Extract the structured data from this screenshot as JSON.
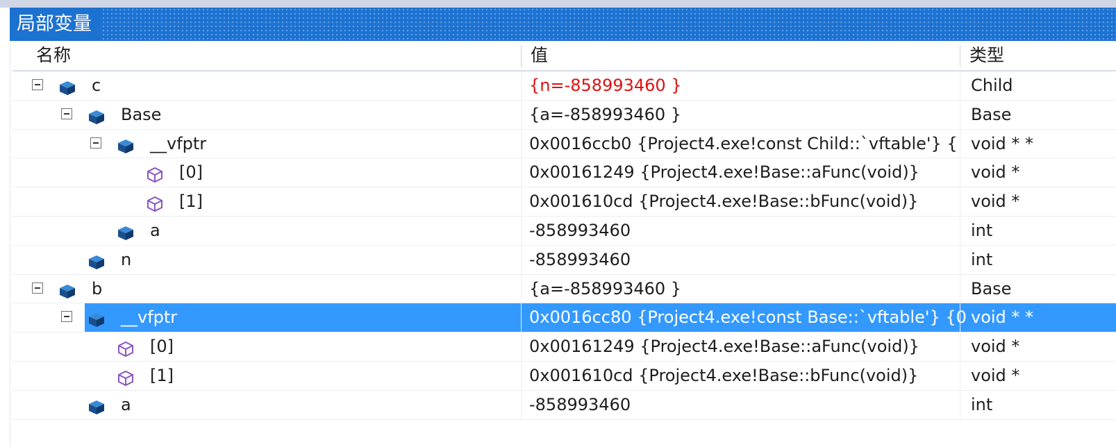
{
  "window": {
    "title": "局部变量"
  },
  "columns": {
    "name": "名称",
    "value": "值",
    "type": "类型"
  },
  "colors": {
    "accent": "#1c72d0",
    "selection": "#3399ff",
    "changed": "#e01010"
  },
  "rows": [
    {
      "name": "c",
      "value": "{n=-858993460 }",
      "type": "Child",
      "depth": 0,
      "expandable": true,
      "icon": "field-icon",
      "changed": true
    },
    {
      "name": "Base",
      "value": "{a=-858993460 }",
      "type": "Base",
      "depth": 1,
      "expandable": true,
      "icon": "field-icon"
    },
    {
      "name": "__vfptr",
      "value": "0x0016ccb0 {Project4.exe!const Child::`vftable'} {",
      "type": "void * *",
      "depth": 2,
      "expandable": true,
      "icon": "field-icon"
    },
    {
      "name": "[0]",
      "value": "0x00161249 {Project4.exe!Base::aFunc(void)}",
      "type": "void *",
      "depth": 3,
      "expandable": false,
      "icon": "element-icon"
    },
    {
      "name": "[1]",
      "value": "0x001610cd {Project4.exe!Base::bFunc(void)}",
      "type": "void *",
      "depth": 3,
      "expandable": false,
      "icon": "element-icon"
    },
    {
      "name": "a",
      "value": "-858993460",
      "type": "int",
      "depth": 2,
      "expandable": false,
      "icon": "field-icon"
    },
    {
      "name": "n",
      "value": "-858993460",
      "type": "int",
      "depth": 1,
      "expandable": false,
      "icon": "field-icon"
    },
    {
      "name": "b",
      "value": "{a=-858993460 }",
      "type": "Base",
      "depth": 0,
      "expandable": true,
      "icon": "field-icon"
    },
    {
      "name": "__vfptr",
      "value": "0x0016cc80 {Project4.exe!const Base::`vftable'} {0",
      "type": "void * *",
      "depth": 1,
      "expandable": true,
      "icon": "field-icon",
      "selected": true
    },
    {
      "name": "[0]",
      "value": "0x00161249 {Project4.exe!Base::aFunc(void)}",
      "type": "void *",
      "depth": 2,
      "expandable": false,
      "icon": "element-icon"
    },
    {
      "name": "[1]",
      "value": "0x001610cd {Project4.exe!Base::bFunc(void)}",
      "type": "void *",
      "depth": 2,
      "expandable": false,
      "icon": "element-icon"
    },
    {
      "name": "a",
      "value": "-858993460",
      "type": "int",
      "depth": 1,
      "expandable": false,
      "icon": "field-icon"
    }
  ]
}
